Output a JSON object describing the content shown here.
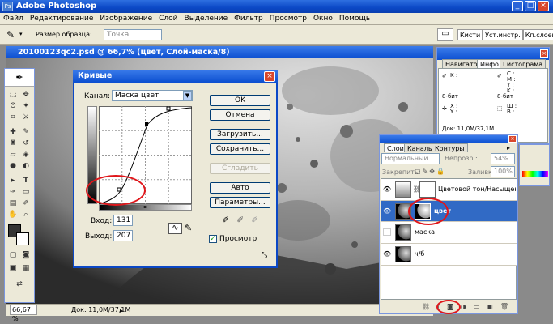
{
  "app": {
    "title": "Adobe Photoshop",
    "logo_text": "Ps"
  },
  "menu": [
    "Файл",
    "Редактирование",
    "Изображение",
    "Слой",
    "Выделение",
    "Фильтр",
    "Просмотр",
    "Окно",
    "Помощь"
  ],
  "options": {
    "sample_size_label": "Размер образца:",
    "sample_size_value": "Точка",
    "well_tabs": [
      "Кисти",
      "Уст.инстр.",
      "Кп.слоев"
    ]
  },
  "document": {
    "title": "20100123qc2.psd @ 66,7% (цвет, Слой-маска/8)",
    "zoom": "66,67 %",
    "doc_info": "Док: 11,0M/37,1M"
  },
  "curves": {
    "title": "Кривые",
    "channel_label": "Канал:",
    "channel_value": "Маска цвет",
    "input_label": "Вход:",
    "input_value": "131",
    "output_label": "Выход:",
    "output_value": "207",
    "buttons": {
      "ok": "OK",
      "cancel": "Отмена",
      "load": "Загрузить...",
      "save": "Сохранить...",
      "smooth": "Сгладить",
      "auto": "Авто",
      "params": "Параметры..."
    },
    "preview_label": "Просмотр",
    "preview_checked": true
  },
  "info_panel": {
    "tabs": [
      "Навигатор",
      "Инфо",
      "Гистограма"
    ],
    "left_top": [
      "K :"
    ],
    "right_top": [
      "C :",
      "M :",
      "Y :",
      "K :"
    ],
    "bit_left": "8-бит",
    "bit_right": "8-бит",
    "xy": [
      "X :",
      "Y :"
    ],
    "wh": [
      "Ш :",
      "В :"
    ],
    "doc": "Док: 11,0M/37,1M"
  },
  "layers_panel": {
    "tabs": [
      "Слои",
      "Каналы",
      "Контуры"
    ],
    "blend_mode": "Нормальный",
    "opacity_label": "Непрозр.:",
    "opacity_value": "54%",
    "lock_label": "Закрепить:",
    "fill_label": "Заливка:",
    "fill_value": "100%",
    "layers": [
      {
        "name": "Цветовой тон/Насыщенность 1",
        "visible": true
      },
      {
        "name": "цвет",
        "visible": true
      },
      {
        "name": "маска",
        "visible": false
      },
      {
        "name": "ч/б",
        "visible": true
      }
    ]
  },
  "colors": {
    "title_blue": "#0b48c6",
    "selection": "#316ac5",
    "annotation_red": "#e0161a"
  }
}
